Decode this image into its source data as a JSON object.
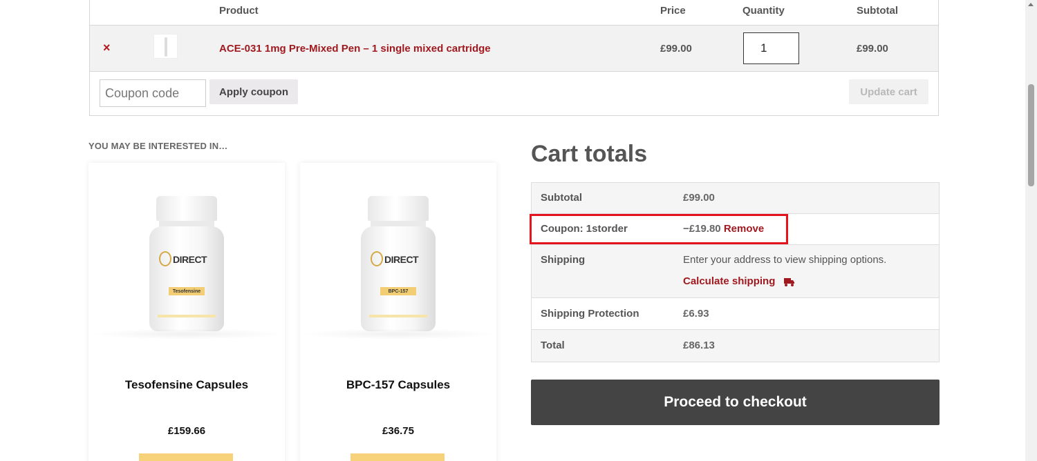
{
  "cart": {
    "headers": [
      "",
      "",
      "Product",
      "Price",
      "Quantity",
      "Subtotal"
    ],
    "item": {
      "remove_symbol": "×",
      "product": "ACE-031 1mg Pre-Mixed Pen – 1 single mixed cartridge",
      "price": "£99.00",
      "quantity": "1",
      "subtotal": "£99.00"
    },
    "coupon_placeholder": "Coupon code",
    "apply_coupon": "Apply coupon",
    "update_cart": "Update cart"
  },
  "interested": {
    "title": "YOU MAY BE INTERESTED IN…",
    "products": [
      {
        "name": "Tesofensine Capsules",
        "price": "£159.66",
        "brand": "DIRECT",
        "label": "Tesofensine"
      },
      {
        "name": "BPC-157 Capsules",
        "price": "£36.75",
        "brand": "DIRECT",
        "label": "BPC-157"
      }
    ]
  },
  "totals": {
    "title": "Cart totals",
    "subtotal_label": "Subtotal",
    "subtotal_value": "£99.00",
    "coupon_label": "Coupon: 1storder",
    "coupon_value": "−£19.80",
    "coupon_remove": "Remove",
    "shipping_label": "Shipping",
    "shipping_text": "Enter your address to view shipping options.",
    "calculate_shipping": "Calculate shipping",
    "protection_label": "Shipping Protection",
    "protection_value": "£6.93",
    "total_label": "Total",
    "total_value": "£86.13",
    "checkout": "Proceed to checkout"
  },
  "colors": {
    "accent_red": "#a0191f",
    "highlight_red": "#e3141b",
    "checkout_bg": "#444444",
    "add_button_yellow": "#f7d27a"
  },
  "icons": {
    "remove": "close-icon",
    "truck": "truck-icon",
    "scroll_up": "chevron-up-icon"
  }
}
